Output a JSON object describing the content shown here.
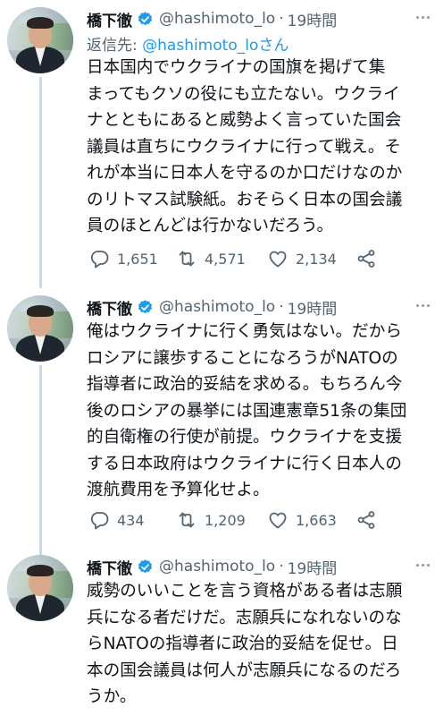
{
  "tweets": [
    {
      "name": "橋下徹",
      "handle": "@hashimoto_lo",
      "separator": "·",
      "time": "19時間",
      "reply_prefix": "返信先: ",
      "reply_mention": "@hashimoto_loさん",
      "text": "日本国内でウクライナの国旗を掲げて集\nまってもクソの役にも立たない。ウクライ\nナとともにあると威勢よく言っていた国会\n議員は直ちにウクライナに行って戦え。そ\nれが本当に日本人を守るのか口だけなのか\nのリトマス試験紙。おそらく日本の国会議\n員のほとんどは行かないだろう。",
      "replies": "1,651",
      "retweets": "4,571",
      "likes": "2,134"
    },
    {
      "name": "橋下徹",
      "handle": "@hashimoto_lo",
      "separator": "·",
      "time": "19時間",
      "text": "俺はウクライナに行く勇気はない。だから\nロシアに譲歩することになろうがNATOの\n指導者に政治的妥結を求める。もちろん今\n後のロシアの暴挙には国連憲章51条の集団\n的自衛権の行使が前提。ウクライナを支援\nする日本政府はウクライナに行く日本人の\n渡航費用を予算化せよ。",
      "replies": "434",
      "retweets": "1,209",
      "likes": "1,663"
    },
    {
      "name": "橋下徹",
      "handle": "@hashimoto_lo",
      "separator": "·",
      "time": "19時間",
      "text": "威勢のいいことを言う資格がある者は志願\n兵になる者だけだ。志願兵になれないのな\nらNATOの指導者に政治的妥結を促せ。日\n本の国会議員は何人が志願兵になるのだろ\nうか。"
    }
  ],
  "colors": {
    "accent": "#1d9bf0",
    "secondary": "#536471",
    "thread": "#cfd9de"
  },
  "icons": [
    "verified-badge-icon",
    "more-icon",
    "reply-icon",
    "retweet-icon",
    "like-icon",
    "share-icon"
  ]
}
